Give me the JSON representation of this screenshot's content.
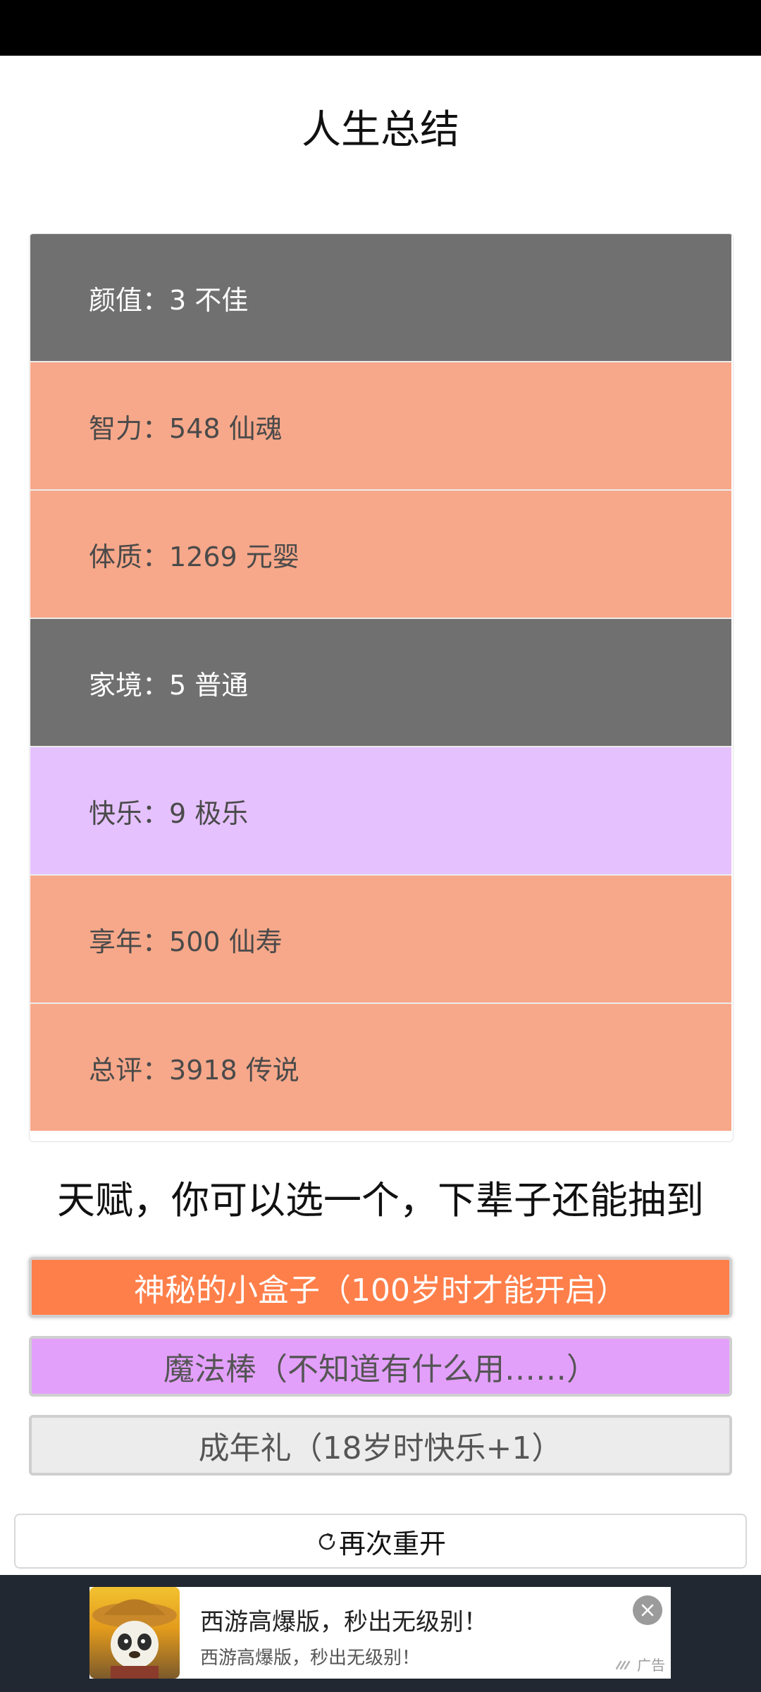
{
  "page": {
    "title": "人生总结"
  },
  "stats": [
    {
      "label": "颜值：",
      "value": "3 不佳",
      "bg": "#707070",
      "color": "#ffffff"
    },
    {
      "label": "智力：",
      "value": "548 仙魂",
      "bg": "#f7a88a",
      "color": "#4a4a4a"
    },
    {
      "label": "体质：",
      "value": "1269 元婴",
      "bg": "#f7a88a",
      "color": "#4a4a4a"
    },
    {
      "label": "家境：",
      "value": "5 普通",
      "bg": "#707070",
      "color": "#ffffff"
    },
    {
      "label": "快乐：",
      "value": "9 极乐",
      "bg": "#e5c1fd",
      "color": "#4a4a4a"
    },
    {
      "label": "享年：",
      "value": "500 仙寿",
      "bg": "#f7a88a",
      "color": "#4a4a4a"
    },
    {
      "label": "总评：",
      "value": "3918 传说",
      "bg": "#f7a88a",
      "color": "#4a4a4a"
    }
  ],
  "talents": {
    "heading": "天赋，你可以选一个，下辈子还能抽到",
    "items": [
      {
        "label": "神秘的小盒子（100岁时才能开启）",
        "bg": "#ff7f4a",
        "color": "#ffffff",
        "selected": true
      },
      {
        "label": "魔法棒（不知道有什么用……）",
        "bg": "#e3a0fb",
        "color": "#555555",
        "selected": false
      },
      {
        "label": "成年礼（18岁时快乐+1）",
        "bg": "#ececec",
        "color": "#555555",
        "selected": false
      }
    ]
  },
  "restart": {
    "label": "再次重开",
    "icon": "refresh-icon"
  },
  "ad": {
    "headline": "西游高爆版，秒出无级别！",
    "subtitle": "西游高爆版，秒出无级别！",
    "badge": "广告",
    "close_icon": "close-icon"
  }
}
